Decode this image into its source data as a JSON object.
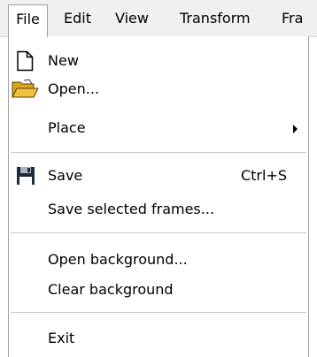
{
  "menubar": {
    "items": [
      {
        "label": "File"
      },
      {
        "label": "Edit"
      },
      {
        "label": "View"
      },
      {
        "label": "Transform"
      },
      {
        "label": "Fra"
      }
    ]
  },
  "file_menu": {
    "new_label": "New",
    "open_label": "Open...",
    "place_label": "Place",
    "save_label": "Save",
    "save_shortcut": "Ctrl+S",
    "save_selected_frames_label": "Save selected frames...",
    "open_background_label": "Open background...",
    "clear_background_label": "Clear background",
    "exit_label": "Exit"
  },
  "icons": {
    "new": "new-document-icon",
    "open": "open-folder-icon",
    "save": "floppy-disk-icon",
    "submenu": "submenu-arrow-icon"
  },
  "colors": {
    "menubar_bg": "#f0f0f0",
    "menu_bg": "#ffffff",
    "separator": "#c8c8c8",
    "folder_yellow": "#f0c040",
    "floppy_dark": "#1e2b38"
  }
}
